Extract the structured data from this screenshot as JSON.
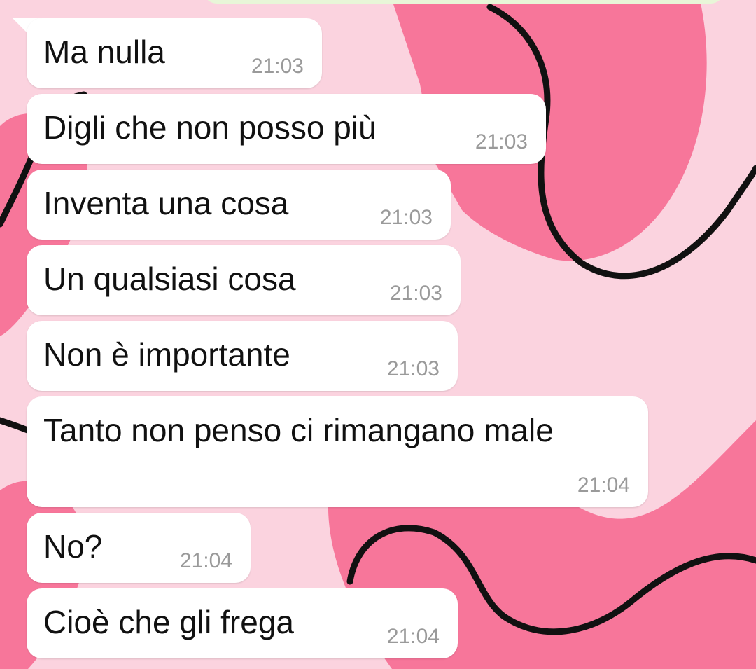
{
  "chat": {
    "messages": [
      {
        "text": "Ma nulla",
        "time": "21:03"
      },
      {
        "text": "Digli che non posso più",
        "time": "21:03"
      },
      {
        "text": "Inventa una cosa",
        "time": "21:03"
      },
      {
        "text": "Un qualsiasi cosa",
        "time": "21:03"
      },
      {
        "text": "Non è importante",
        "time": "21:03"
      },
      {
        "text": "Tanto non penso ci rimangano male",
        "time": "21:04"
      },
      {
        "text": "No?",
        "time": "21:04"
      },
      {
        "text": "Cioè che gli frega",
        "time": "21:04"
      }
    ]
  },
  "theme": {
    "bubble_color": "#ffffff",
    "text_color": "#111111",
    "time_color": "#9a9a9a",
    "wallpaper_light": "#fbd3df",
    "wallpaper_dark": "#f7769a",
    "wallpaper_line": "#111111",
    "sent_bubble_color": "#e8f6d8"
  }
}
